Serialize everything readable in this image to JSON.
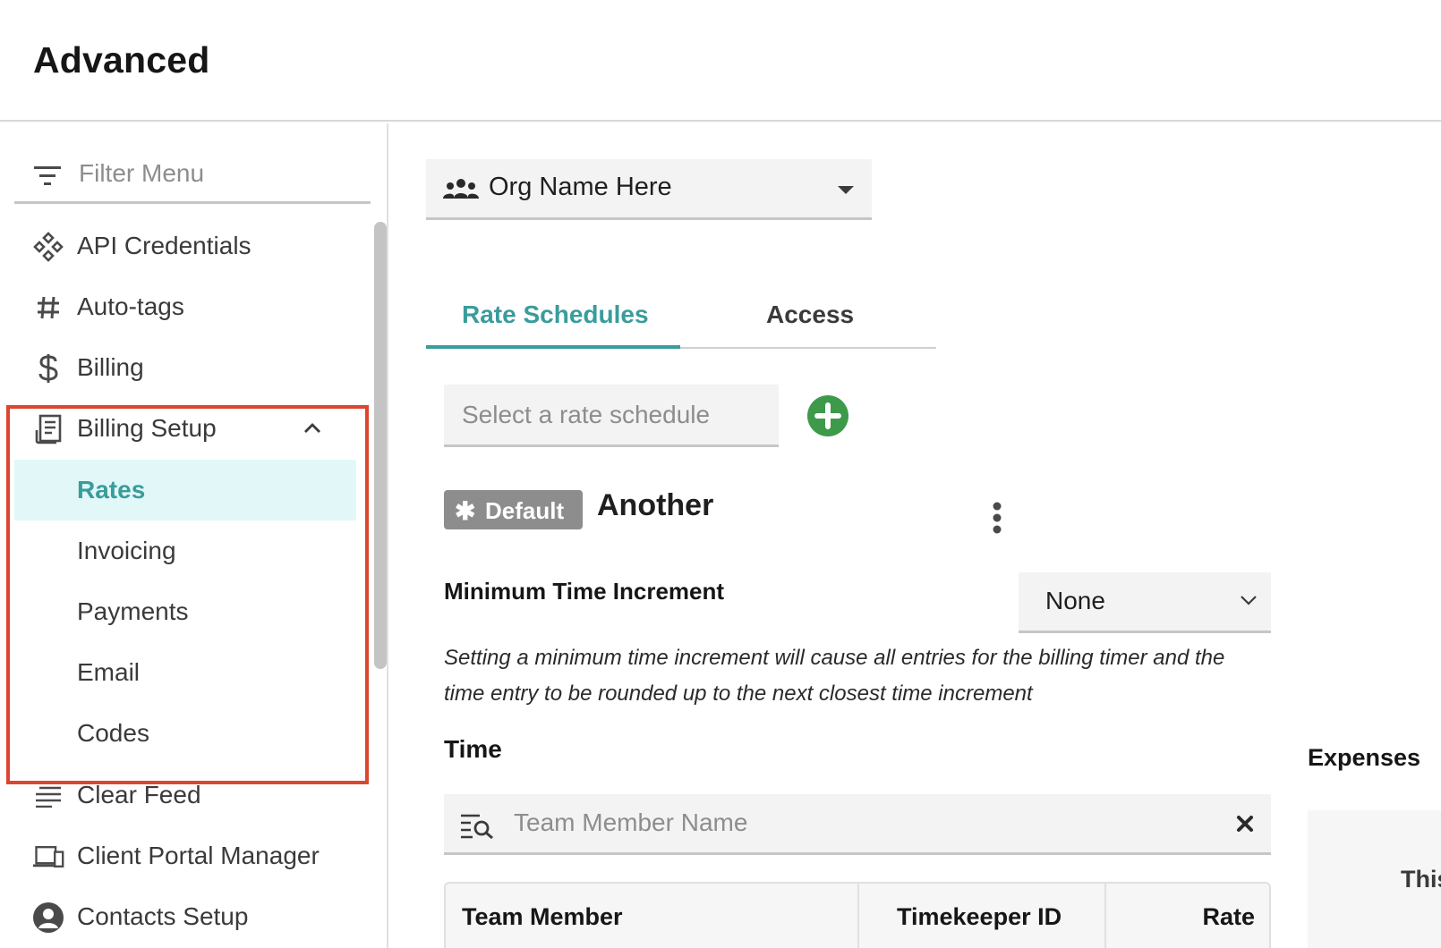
{
  "header": {
    "title": "Advanced"
  },
  "sidebar": {
    "filter_placeholder": "Filter Menu",
    "items": [
      {
        "label": "API Credentials",
        "icon": "api-credentials-icon"
      },
      {
        "label": "Auto-tags",
        "icon": "hashtag-icon"
      },
      {
        "label": "Billing",
        "icon": "dollar-icon"
      },
      {
        "label": "Billing Setup",
        "icon": "receipt-icon",
        "expanded": true
      },
      {
        "label": "Clear Feed",
        "icon": "feed-icon"
      },
      {
        "label": "Client Portal Manager",
        "icon": "devices-icon"
      },
      {
        "label": "Contacts Setup",
        "icon": "person-icon"
      }
    ],
    "billing_setup_children": [
      {
        "label": "Rates",
        "active": true
      },
      {
        "label": "Invoicing"
      },
      {
        "label": "Payments"
      },
      {
        "label": "Email"
      },
      {
        "label": "Codes"
      }
    ]
  },
  "main": {
    "org_select": {
      "value": "Org Name Here",
      "icon": "group-icon"
    },
    "tabs": [
      {
        "label": "Rate Schedules",
        "active": true
      },
      {
        "label": "Access"
      }
    ],
    "rate_schedule_placeholder": "Select a rate schedule",
    "default_badge": "Default",
    "schedule_name": "Another",
    "min_time_increment": {
      "label": "Minimum Time Increment",
      "value": "None",
      "help": "Setting a minimum time increment will cause all entries for the billing timer and the time entry to be rounded up to the next closest time increment"
    },
    "time_label": "Time",
    "expenses_label": "Expenses",
    "member_search_placeholder": "Team Member Name",
    "table_headers": [
      "Team Member",
      "Timekeeper ID",
      "Rate"
    ],
    "expenses_text": "This"
  },
  "colors": {
    "accent": "#3a9c9c",
    "active_bg": "#e2f8f8",
    "highlight": "#dc4530",
    "add_button": "#3d9a4a",
    "badge": "#8d8d8d"
  }
}
